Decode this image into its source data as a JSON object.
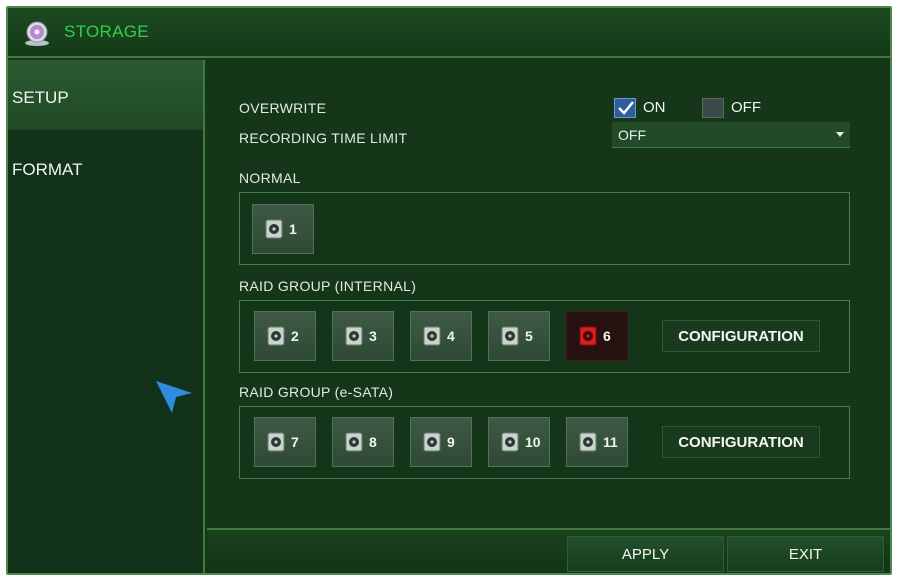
{
  "window": {
    "title": "STORAGE",
    "title_icon": "storage-disc-icon",
    "accent_color": "#33d14a"
  },
  "sidebar": {
    "items": [
      {
        "label": "SETUP",
        "active": true
      },
      {
        "label": "FORMAT",
        "active": false
      }
    ]
  },
  "overwrite": {
    "label": "OVERWRITE",
    "on_label": "ON",
    "off_label": "OFF",
    "on_checked": true,
    "off_checked": false
  },
  "recording_time_limit": {
    "label": "RECORDING TIME LIMIT",
    "value": "OFF"
  },
  "normal": {
    "label": "NORMAL",
    "disks": [
      {
        "num": "1",
        "status": "normal"
      }
    ]
  },
  "raid_internal": {
    "label": "RAID GROUP (INTERNAL)",
    "disks": [
      {
        "num": "2",
        "status": "normal"
      },
      {
        "num": "3",
        "status": "normal"
      },
      {
        "num": "4",
        "status": "normal"
      },
      {
        "num": "5",
        "status": "normal"
      },
      {
        "num": "6",
        "status": "error"
      }
    ],
    "config_label": "CONFIGURATION"
  },
  "raid_esata": {
    "label": "RAID GROUP (e-SATA)",
    "disks": [
      {
        "num": "7",
        "status": "normal"
      },
      {
        "num": "8",
        "status": "normal"
      },
      {
        "num": "9",
        "status": "normal"
      },
      {
        "num": "10",
        "status": "normal"
      },
      {
        "num": "11",
        "status": "normal"
      }
    ],
    "config_label": "CONFIGURATION"
  },
  "footer": {
    "apply_label": "APPLY",
    "exit_label": "EXIT"
  },
  "colors": {
    "disk_error": "#d81e1e",
    "checkbox_on": "#2d5d9a",
    "cursor": "#2f8de0"
  }
}
